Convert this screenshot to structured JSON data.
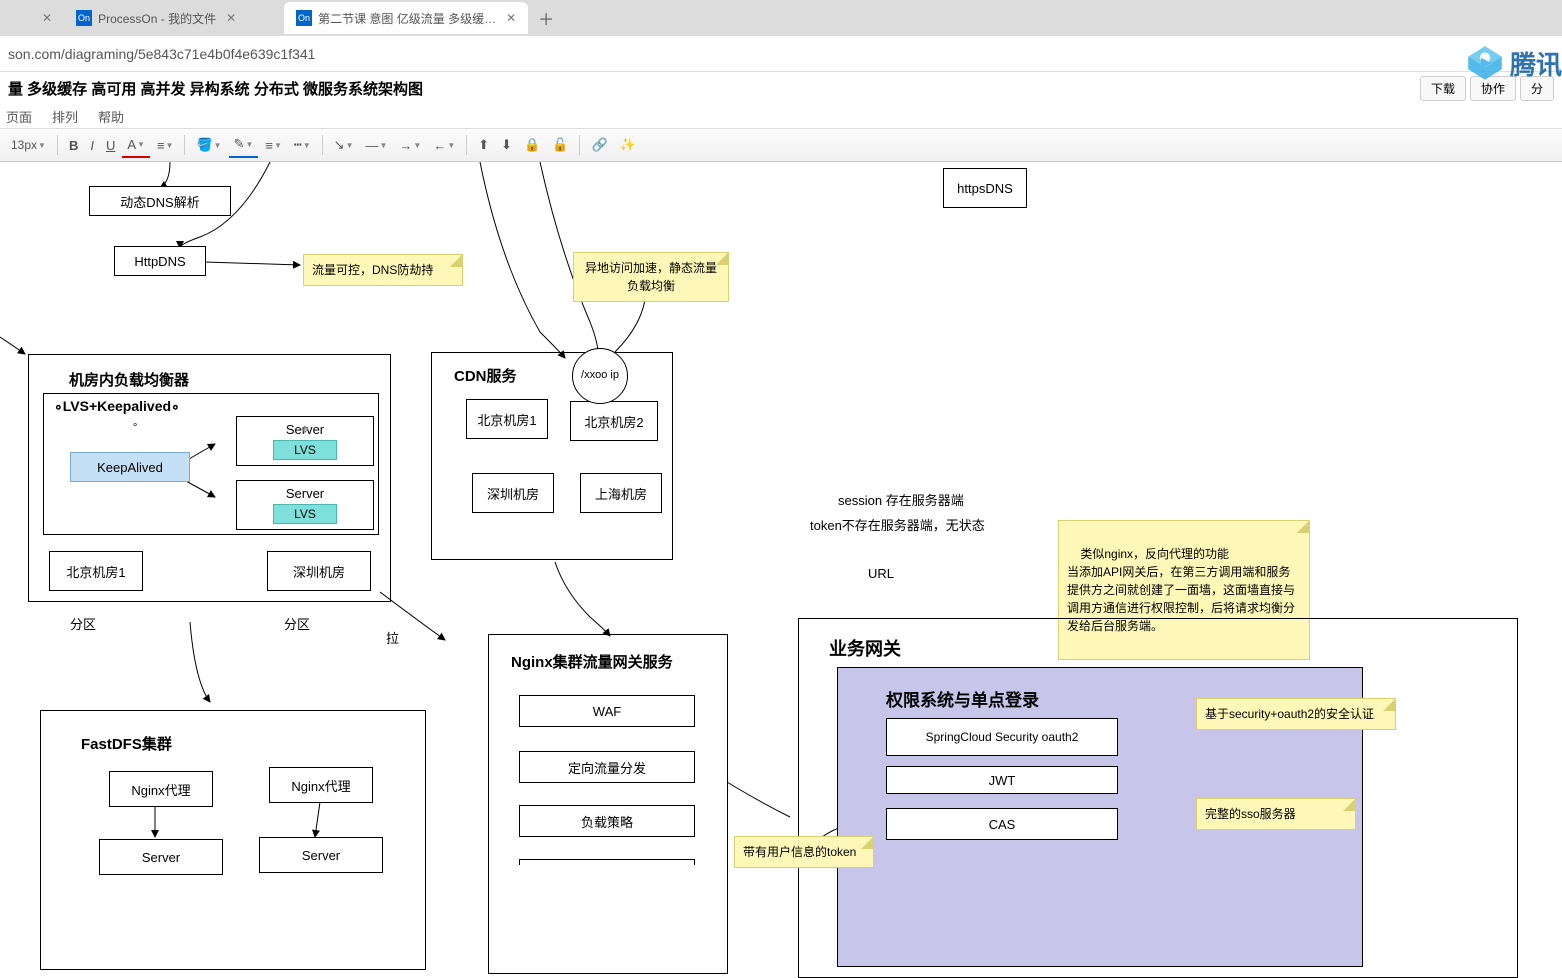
{
  "browser": {
    "tabs": [
      {
        "label": "",
        "active": false
      },
      {
        "label": "ProcessOn - 我的文件",
        "active": false
      },
      {
        "label": "第二节课 意图 亿级流量 多级缓…",
        "active": true
      }
    ],
    "tab_icon": "On",
    "url": "son.com/diagraming/5e843c71e4b0f4e639c1f341"
  },
  "header": {
    "title": "量 多级缓存 高可用 高并发 异构系统 分布式 微服务系统架构图",
    "actions": {
      "download": "下载",
      "collab": "协作",
      "share": "分"
    }
  },
  "menu": {
    "page": "页面",
    "arrange": "排列",
    "help": "帮助"
  },
  "toolbar": {
    "font_size": "13px"
  },
  "watermark": {
    "text": "腾讯"
  },
  "diagram": {
    "httpsdns": "httpsDNS",
    "dns_box": "动态DNS解析",
    "httpdns_box": "HttpDNS",
    "note_dns": "流量可控，DNS防劫持",
    "note_cdn": "异地访问加速，静态流量负载均衡",
    "lb_group": {
      "title": "机房内负载均衡器",
      "inner_title": "∘LVS+Keepalived∘",
      "keepalived": "KeepAlived",
      "server1": "Server",
      "server2": "Server",
      "lvs": "LVS",
      "room_bj": "北京机房1",
      "room_sz": "深圳机房",
      "zone": "分区"
    },
    "cdn": {
      "title": "CDN服务",
      "circle": "/xxoo ip",
      "bj1": "北京机房1",
      "bj2": "北京机房2",
      "sz": "深圳机房",
      "sh": "上海机房"
    },
    "pull_label": "拉",
    "session_text1": "session 存在服务器端",
    "session_text2": "token不存在服务器端，无状态",
    "session_url": "URL",
    "note_nginx": "类似nginx，反向代理的功能\n当添加API网关后，在第三方调用端和服务提供方之间就创建了一面墙，这面墙直接与调用方通信进行权限控制，后将请求均衡分发给后台服务端。",
    "fastdfs": {
      "title": "FastDFS集群",
      "nginx1": "Nginx代理",
      "nginx2": "Nginx代理",
      "server1": "Server",
      "server2": "Server"
    },
    "nginx_gw": {
      "title": "Nginx集群流量网关服务",
      "waf": "WAF",
      "directed": "定向流量分发",
      "lb": "负载策略"
    },
    "biz_gw": {
      "title": "业务网关",
      "auth_title": "权限系统与单点登录",
      "spring": "SpringCloud Security oauth2",
      "jwt": "JWT",
      "cas": "CAS"
    },
    "note_security": "基于security+oauth2的安全认证",
    "note_sso": "完整的sso服务器",
    "note_token": "带有用户信息的token"
  }
}
